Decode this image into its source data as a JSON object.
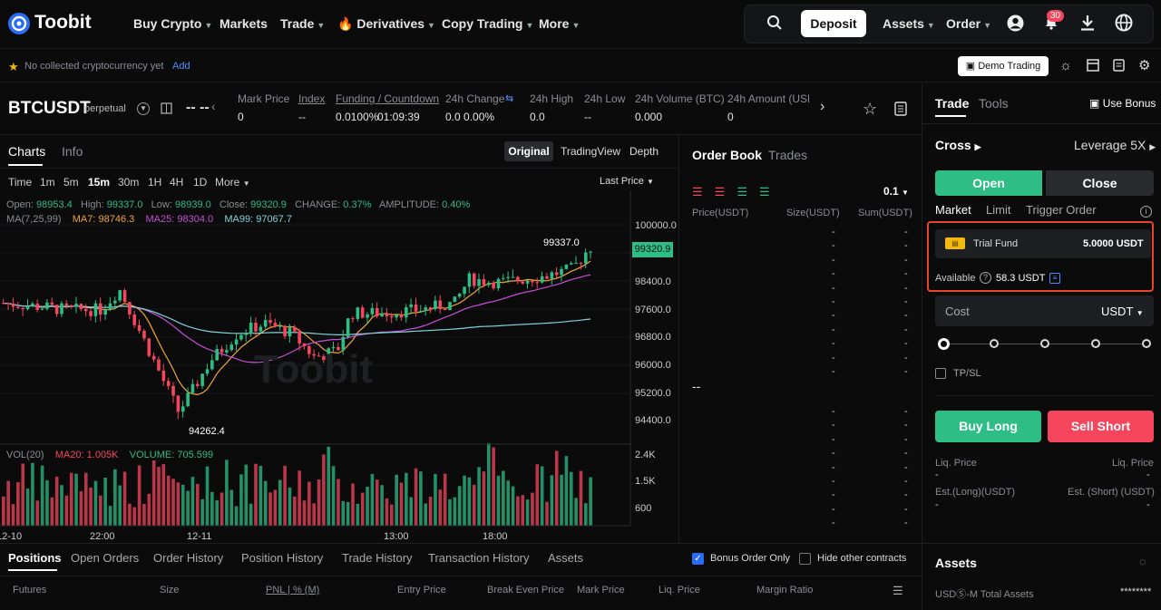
{
  "brand": {
    "name": "Toobit"
  },
  "nav": {
    "items": [
      "Buy Crypto",
      "Markets",
      "Trade",
      "Derivatives",
      "Copy Trading",
      "More"
    ],
    "deposit": "Deposit",
    "assets": "Assets",
    "order": "Order",
    "notif_count": "30"
  },
  "subbar": {
    "fav_text": "No collected cryptocurrency yet",
    "fav_add": "Add",
    "demo": "Demo Trading"
  },
  "ticker": {
    "symbol": "BTCUSDT",
    "type": "perpetual",
    "price": "-- --",
    "fields": [
      {
        "label": "Mark Price",
        "value": "0"
      },
      {
        "label": "Index",
        "value": "--"
      },
      {
        "label": "Funding / Countdown",
        "value": "0.0100%",
        "extra": "01:09:39"
      },
      {
        "label": "24h Change",
        "value": "0.0 0.00%"
      },
      {
        "label": "24h High",
        "value": "0.0"
      },
      {
        "label": "24h Low",
        "value": "--"
      },
      {
        "label": "24h Volume (BTC)",
        "value": "0.000"
      },
      {
        "label": "24h Amount (USDT)",
        "value": "0"
      }
    ]
  },
  "chart_tabs": {
    "charts": "Charts",
    "info": "Info",
    "original": "Original",
    "tradingview": "TradingView",
    "depth": "Depth"
  },
  "intervals": [
    "Time",
    "1m",
    "5m",
    "15m",
    "30m",
    "1H",
    "4H",
    "1D",
    "More"
  ],
  "last_price": "Last Price",
  "ohlc": {
    "open_l": "Open:",
    "open": "98953.4",
    "high_l": "High:",
    "high": "99337.0",
    "low_l": "Low:",
    "low": "98939.0",
    "close_l": "Close:",
    "close": "99320.9",
    "change_l": "CHANGE:",
    "change": "0.37%",
    "amp_l": "AMPLITUDE:",
    "amp": "0.40%"
  },
  "ma": {
    "label": "MA(7,25,99)",
    "ma7": "MA7: 98746.3",
    "ma25": "MA25: 98304.0",
    "ma99": "MA99: 97067.7"
  },
  "vol": {
    "label": "VOL(20)",
    "ma20": "MA20: 1.005K",
    "volume": "VOLUME: 705.599"
  },
  "watermark": "Toobit",
  "chart_data": {
    "type": "candlestick",
    "price_axis": [
      "100000.0",
      "98400.0",
      "97600.0",
      "96800.0",
      "96000.0",
      "95200.0",
      "94400.0"
    ],
    "current_price": "99320.9",
    "high_marker": "99337.0",
    "low_marker": "94262.4",
    "volume_axis": [
      "2.4K",
      "1.5K",
      "600"
    ],
    "time_axis": [
      "12-10",
      "22:00",
      "12-11",
      "13:00",
      "18:00"
    ],
    "colors": {
      "up": "#2ebd85",
      "down": "#f6465d",
      "ma7": "#f0a53b",
      "ma25": "#c74fd6",
      "ma99": "#7fd3d9"
    }
  },
  "orderbook": {
    "tab": "Order Book",
    "trades": "Trades",
    "step": "0.1",
    "cols": [
      "Price(USDT)",
      "Size(USDT)",
      "Sum(USDT)"
    ],
    "mid": "--"
  },
  "trade_panel": {
    "tab_trade": "Trade",
    "tab_tools": "Tools",
    "use_bonus": "Use Bonus",
    "margin": "Cross",
    "leverage": "Leverage 5X",
    "open": "Open",
    "close": "Close",
    "order_types": [
      "Market",
      "Limit",
      "Trigger Order"
    ],
    "trial_label": "Trial Fund",
    "trial_value": "5.0000 USDT",
    "available_label": "Available",
    "available_value": "58.3 USDT",
    "cost": "Cost",
    "cost_unit": "USDT",
    "tpsl": "TP/SL",
    "buy": "Buy Long",
    "sell": "Sell Short",
    "liq_l": "Liq. Price",
    "liq_r": "Liq. Price",
    "dash": "-",
    "est_long": "Est.(Long)(USDT)",
    "est_short": "Est. (Short) (USDT)"
  },
  "bottom": {
    "tabs": [
      "Positions",
      "Open Orders",
      "Order History",
      "Position History",
      "Trade History",
      "Transaction History",
      "Assets"
    ],
    "bonus_only": "Bonus Order Only",
    "hide_other": "Hide other contracts",
    "cols": [
      "Futures",
      "Size",
      "PNL | % (M)",
      "Entry Price",
      "Break Even Price",
      "Mark Price",
      "Liq. Price",
      "Margin Ratio"
    ]
  },
  "assets_panel": {
    "title": "Assets",
    "total_label": "USDⓈ-M Total Assets",
    "total_value": "********"
  }
}
